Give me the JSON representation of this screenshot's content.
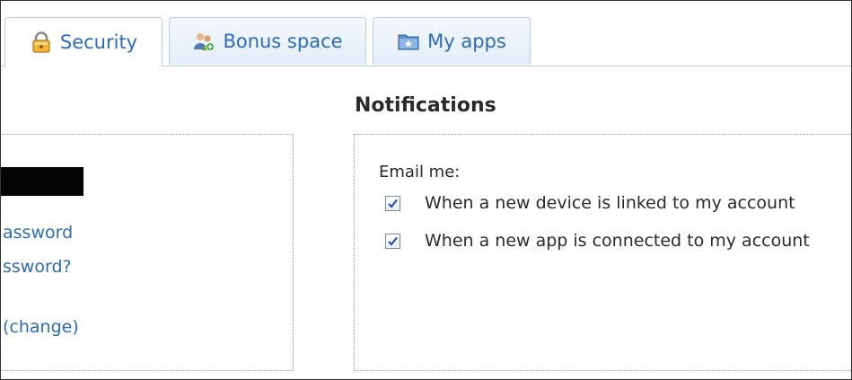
{
  "tabs": [
    {
      "label": "Security",
      "icon": "lock-icon",
      "active": true
    },
    {
      "label": "Bonus space",
      "icon": "users-icon",
      "active": false
    },
    {
      "label": "My apps",
      "icon": "apps-folder-icon",
      "active": false
    }
  ],
  "account": {
    "links": [
      {
        "label": "assword"
      },
      {
        "label": "ssword?"
      },
      {
        "label": "(change)"
      }
    ]
  },
  "notifications": {
    "title": "Notifications",
    "email_label": "Email me:",
    "options": [
      {
        "label": "When a new device is linked to my account",
        "checked": true
      },
      {
        "label": "When a new app is connected to my account",
        "checked": true
      }
    ]
  },
  "colors": {
    "link": "#2c6bb5",
    "tab_border": "#b7cde3",
    "check": "#2a4fa8"
  }
}
